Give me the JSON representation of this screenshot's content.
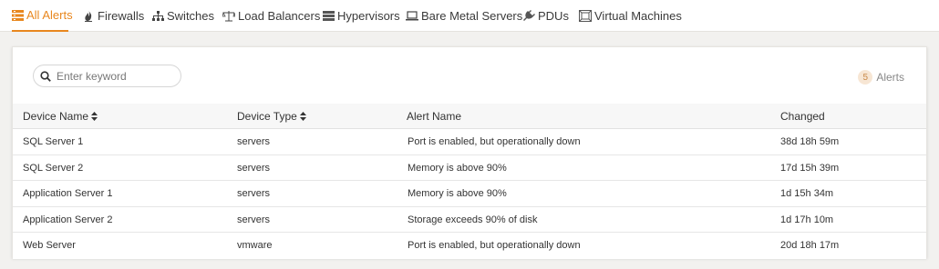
{
  "tabs": [
    {
      "label": "All Alerts",
      "icon": "stack-list-icon",
      "active": true
    },
    {
      "label": "Firewalls",
      "icon": "fire-icon",
      "active": false
    },
    {
      "label": "Switches",
      "icon": "sitemap-icon",
      "active": false
    },
    {
      "label": "Load Balancers",
      "icon": "balance-scale-icon",
      "active": false
    },
    {
      "label": "Hypervisors",
      "icon": "server-stack-icon",
      "active": false
    },
    {
      "label": "Bare Metal Servers",
      "icon": "laptop-icon",
      "active": false
    },
    {
      "label": "PDUs",
      "icon": "plug-icon",
      "active": false
    },
    {
      "label": "Virtual Machines",
      "icon": "virtual-machine-icon",
      "active": false
    }
  ],
  "search": {
    "placeholder": "Enter keyword",
    "value": ""
  },
  "alerts_summary": {
    "count": "5",
    "label": "Alerts"
  },
  "table": {
    "headers": [
      "Device Name",
      "Device Type",
      "Alert Name",
      "Changed"
    ],
    "rows": [
      [
        "SQL Server 1",
        "servers",
        "Port is enabled, but operationally down",
        "38d 18h 59m"
      ],
      [
        "SQL Server 2",
        "servers",
        "Memory is above 90%",
        "17d 15h 39m"
      ],
      [
        "Application Server 1",
        "servers",
        "Memory is above 90%",
        "1d 15h 34m"
      ],
      [
        "Application Server 2",
        "servers",
        "Storage exceeds 90% of disk",
        "1d 17h 10m"
      ],
      [
        "Web Server",
        "vmware",
        "Port is enabled, but operationally down",
        "20d 18h 17m"
      ]
    ]
  },
  "colors": {
    "accent": "#e8871e",
    "badge_bg": "#f7e6d4",
    "header_bg": "#f7f7f7",
    "page_bg": "#f2f1ef"
  }
}
